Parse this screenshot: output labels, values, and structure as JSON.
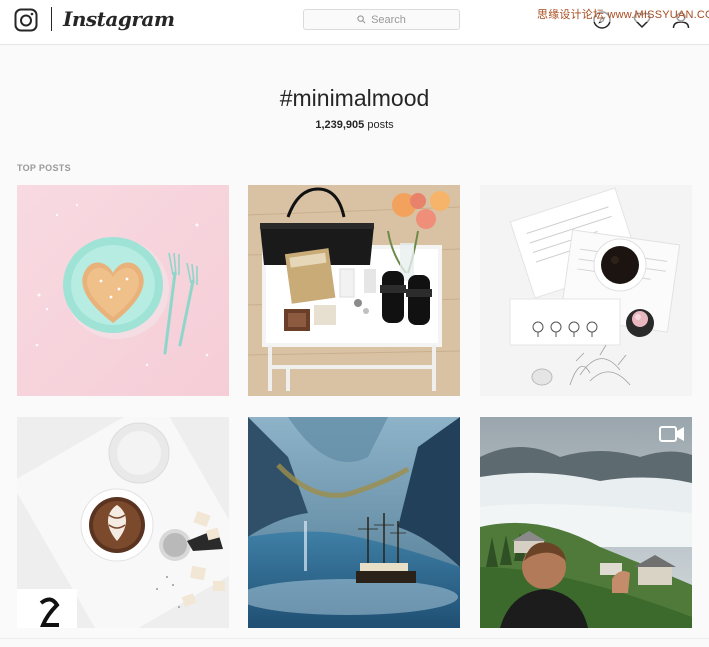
{
  "header": {
    "logo_text": "Instagram",
    "search_placeholder": "Search",
    "watermark": "思缘设计论坛 www.MISSYUAN.COM"
  },
  "hashtag": {
    "title": "#minimalmood",
    "count": "1,239,905",
    "count_label": " posts"
  },
  "section": {
    "top_posts_label": "TOP POSTS"
  },
  "posts": [
    {
      "subject": "heart pancake on mint plate with forks"
    },
    {
      "subject": "handbag, shoes and roses on white cart"
    },
    {
      "subject": "coffee, papers and watches flat lay"
    },
    {
      "subject": "latte art with cookies"
    },
    {
      "subject": "tall ship in mountain fjord"
    },
    {
      "subject": "man above clouds in mountains",
      "is_video": true
    }
  ],
  "colors": {
    "background": "#fafafa",
    "topbar": "#ffffff",
    "text": "#262626",
    "muted": "#999999"
  }
}
